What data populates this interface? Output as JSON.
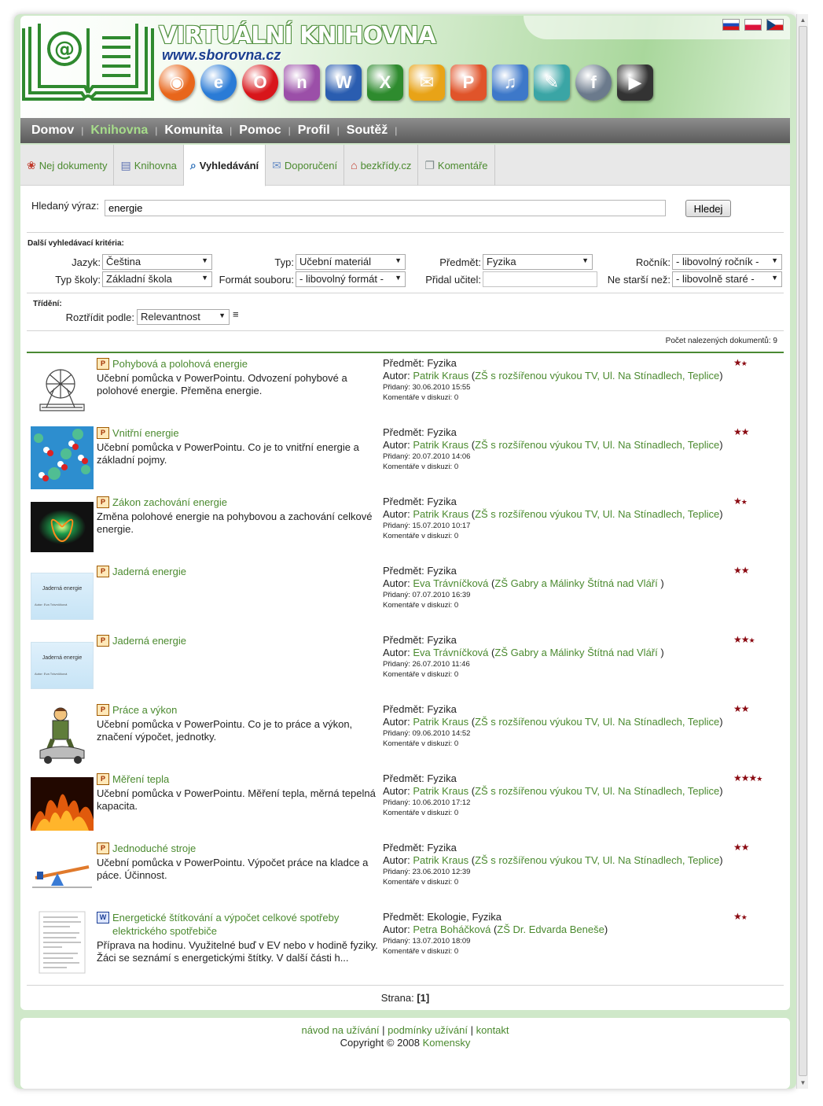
{
  "header": {
    "title": "VIRTUÁLNÍ KNIHOVNA",
    "url": "www.sborovna.cz",
    "flags": [
      "slovak-flag",
      "polish-flag",
      "czech-flag"
    ],
    "app_icons": [
      {
        "name": "firefox-icon",
        "glyph": "◉",
        "color": "#e8661b"
      },
      {
        "name": "internet-explorer-icon",
        "glyph": "e",
        "color": "#2a7bd6"
      },
      {
        "name": "opera-icon",
        "glyph": "O",
        "color": "#d8161b"
      },
      {
        "name": "onenote-icon",
        "glyph": "n",
        "color": "#9b4fa8"
      },
      {
        "name": "word-icon",
        "glyph": "W",
        "color": "#2a5db0"
      },
      {
        "name": "excel-icon",
        "glyph": "X",
        "color": "#2e8b2e"
      },
      {
        "name": "outlook-icon",
        "glyph": "✉",
        "color": "#e8a317"
      },
      {
        "name": "powerpoint-icon",
        "glyph": "P",
        "color": "#e0542a"
      },
      {
        "name": "itunes-icon",
        "glyph": "♫",
        "color": "#3d78c9"
      },
      {
        "name": "publisher-icon",
        "glyph": "✎",
        "color": "#3aa5a5"
      },
      {
        "name": "flash-icon",
        "glyph": "f",
        "color": "#6b7a8c"
      },
      {
        "name": "avi-video-icon",
        "glyph": "▶",
        "color": "#333333"
      }
    ]
  },
  "nav": {
    "items": [
      {
        "label": "Domov",
        "active": false
      },
      {
        "label": "Knihovna",
        "active": true
      },
      {
        "label": "Komunita",
        "active": false
      },
      {
        "label": "Pomoc",
        "active": false
      },
      {
        "label": "Profil",
        "active": false
      },
      {
        "label": "Soutěž",
        "active": false
      }
    ]
  },
  "tabs": [
    {
      "label": "Nej dokumenty",
      "icon": "award-icon",
      "glyph": "❀",
      "active": false
    },
    {
      "label": "Knihovna",
      "icon": "library-icon",
      "glyph": "▤",
      "active": false
    },
    {
      "label": "Vyhledávání",
      "icon": "search-icon",
      "glyph": "⌕",
      "active": true
    },
    {
      "label": "Doporučení",
      "icon": "envelope-icon",
      "glyph": "✉",
      "active": false
    },
    {
      "label": "bezkřídy.cz",
      "icon": "home-icon",
      "glyph": "⌂",
      "active": false
    },
    {
      "label": "Komentáře",
      "icon": "comments-icon",
      "glyph": "❐",
      "active": false
    }
  ],
  "search": {
    "label": "Hledaný výraz:",
    "value": "energie",
    "button": "Hledej"
  },
  "criteria": {
    "title": "Další vyhledávací kritéria:",
    "jazyk_label": "Jazyk:",
    "jazyk_value": "Čeština",
    "typ_label": "Typ:",
    "typ_value": "Učební materiál",
    "predmet_label": "Předmět:",
    "predmet_value": "Fyzika",
    "rocnik_label": "Ročník:",
    "rocnik_value": "- libovolný ročník -",
    "typ_skoly_label": "Typ školy:",
    "typ_skoly_value": "Základní škola",
    "format_label": "Formát souboru:",
    "format_value": "- libovolný formát -",
    "pridal_label": "Přidal učitel:",
    "pridal_value": "",
    "starsi_label": "Ne starší než:",
    "starsi_value": "- libovolně staré -"
  },
  "sort": {
    "title": "Třídění:",
    "label": "Roztřídit podle:",
    "value": "Relevantnost"
  },
  "count": "Počet nalezených dokumentů: 9",
  "results": [
    {
      "title": "Pohybová a polohová energie",
      "file_type": "powerpoint",
      "desc": "Učební pomůcka v PowerPointu. Odvození pohybové a polohové energie. Přeměna energie.",
      "subject": "Předmět: Fyzika",
      "author_label": "Autor:",
      "author": "Patrik Kraus",
      "school": "ZŠ s rozšířenou výukou TV, Ul. Na Stínadlech, Teplice",
      "added": "Přidaný: 30.06.2010 15:55",
      "comments": "Komentáře v diskuzi: 0",
      "rating": 1.5,
      "thumb": "drawing",
      "thumb_label": ""
    },
    {
      "title": "Vnitřní energie",
      "file_type": "powerpoint",
      "desc": "Učební pomůcka v PowerPointu. Co je to vnitřní energie a základní pojmy.",
      "subject": "Předmět: Fyzika",
      "author_label": "Autor:",
      "author": "Patrik Kraus",
      "school": "ZŠ s rozšířenou výukou TV, Ul. Na Stínadlech, Teplice",
      "added": "Přidaný: 20.07.2010 14:06",
      "comments": "Komentáře v diskuzi: 0",
      "rating": 2,
      "thumb": "molecules",
      "thumb_label": ""
    },
    {
      "title": "Zákon zachování energie",
      "file_type": "powerpoint",
      "desc": "Změna polohové energie na pohybovou a zachování celkové energie.",
      "subject": "Předmět: Fyzika",
      "author_label": "Autor:",
      "author": "Patrik Kraus",
      "school": "ZŠ s rozšířenou výukou TV, Ul. Na Stínadlech, Teplice",
      "added": "Přidaný: 15.07.2010 10:17",
      "comments": "Komentáře v diskuzi: 0",
      "rating": 1.5,
      "thumb": "glow",
      "thumb_label": ""
    },
    {
      "title": "Jaderná energie",
      "file_type": "powerpoint",
      "desc": "",
      "subject": "Předmět: Fyzika",
      "author_label": "Autor:",
      "author": "Eva Trávníčková",
      "school": "ZŠ Gabry a Málinky Štítná nad Vláří ",
      "added": "Přidaný: 07.07.2010 16:39",
      "comments": "Komentáře v diskuzi: 0",
      "rating": 2,
      "thumb": "slide",
      "thumb_label": "Jaderná energie"
    },
    {
      "title": "Jaderná energie",
      "file_type": "powerpoint",
      "desc": "",
      "subject": "Předmět: Fyzika",
      "author_label": "Autor:",
      "author": "Eva Trávníčková",
      "school": "ZŠ Gabry a Málinky Štítná nad Vláří ",
      "added": "Přidaný: 26.07.2010 11:46",
      "comments": "Komentáře v diskuzi: 0",
      "rating": 2.5,
      "thumb": "slide",
      "thumb_label": "Jaderná energie"
    },
    {
      "title": "Práce a výkon",
      "file_type": "powerpoint",
      "desc": "Učební pomůcka v PowerPointu. Co je to práce a výkon, značení výpočet, jednotky.",
      "subject": "Předmět: Fyzika",
      "author_label": "Autor:",
      "author": "Patrik Kraus",
      "school": "ZŠ s rozšířenou výukou TV, Ul. Na Stínadlech, Teplice",
      "added": "Přidaný: 09.06.2010 14:52",
      "comments": "Komentáře v diskuzi: 0",
      "rating": 2,
      "thumb": "worker",
      "thumb_label": ""
    },
    {
      "title": "Měření tepla",
      "file_type": "powerpoint",
      "desc": "Učební pomůcka v PowerPointu. Měření tepla, měrná tepelná kapacita.",
      "subject": "Předmět: Fyzika",
      "author_label": "Autor:",
      "author": "Patrik Kraus",
      "school": "ZŠ s rozšířenou výukou TV, Ul. Na Stínadlech, Teplice",
      "added": "Přidaný: 10.06.2010 17:12",
      "comments": "Komentáře v diskuzi: 0",
      "rating": 3.5,
      "thumb": "fire",
      "thumb_label": ""
    },
    {
      "title": "Jednoduché stroje",
      "file_type": "powerpoint",
      "desc": "Učební pomůcka v PowerPointu. Výpočet práce na kladce a páce. Účinnost.",
      "subject": "Předmět: Fyzika",
      "author_label": "Autor:",
      "author": "Patrik Kraus",
      "school": "ZŠ s rozšířenou výukou TV, Ul. Na Stínadlech, Teplice",
      "added": "Přidaný: 23.06.2010 12:39",
      "comments": "Komentáře v diskuzi: 0",
      "rating": 2,
      "thumb": "lever",
      "thumb_label": ""
    },
    {
      "title": "Energetické štítkování a výpočet celkové spotřeby elektrického spotřebiče",
      "file_type": "word",
      "desc": "Příprava na hodinu. Využitelné buď v EV nebo v hodině fyziky. Žáci se seznámí s energetickými štítky. V další části h...",
      "subject": "Předmět: Ekologie, Fyzika",
      "author_label": "Autor:",
      "author": "Petra Boháčková",
      "school": "ZŠ Dr. Edvarda Beneše",
      "added": "Přidaný: 13.07.2010 18:09",
      "comments": "Komentáře v diskuzi: 0",
      "rating": 1.5,
      "thumb": "document",
      "thumb_label": ""
    }
  ],
  "pager": {
    "label": "Strana:",
    "current": "[1]"
  },
  "footer": {
    "links": [
      "návod na užívání",
      "podmínky užívání",
      "kontakt"
    ],
    "copyright": "Copyright © 2008",
    "brand": "Komensky"
  },
  "colors": {
    "accent_green": "#4b8a2f",
    "star_red": "#8b0a12",
    "nav_gray": "#6b6b6b"
  }
}
